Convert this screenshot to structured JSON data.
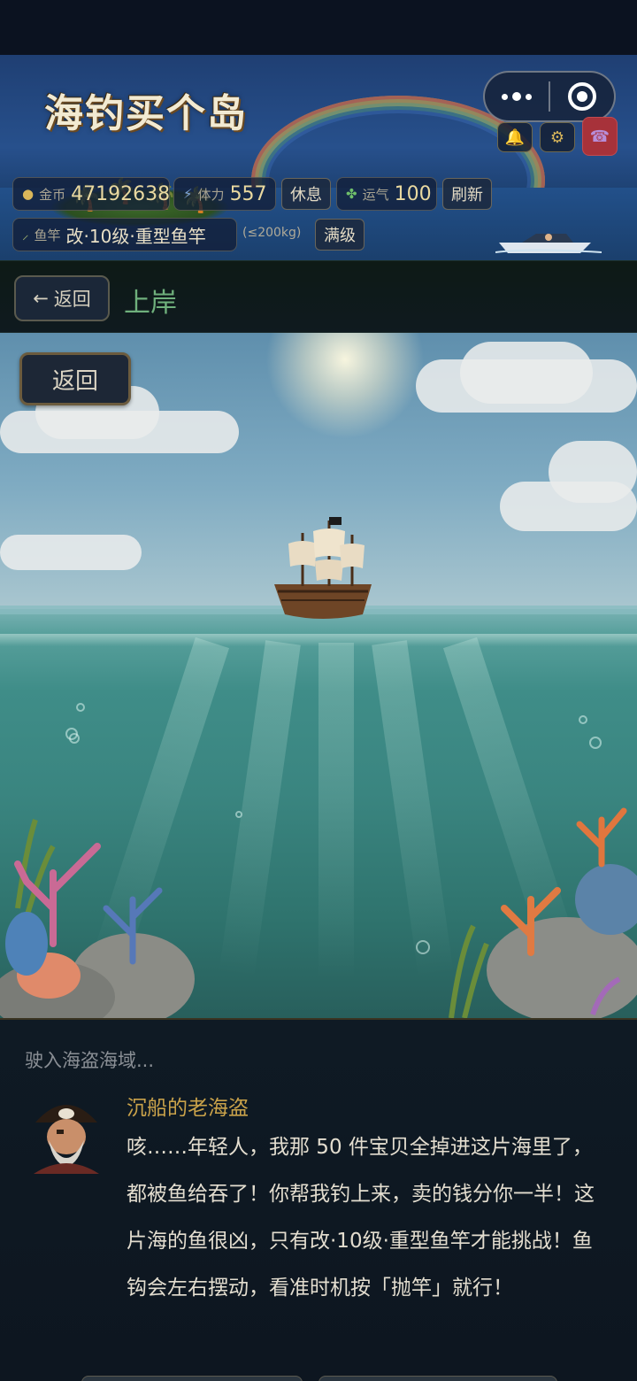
{
  "header": {
    "logo_text": "海钓买个岛",
    "stats": {
      "gold_label": "金币",
      "gold_value": "47192638",
      "stamina_label": "体力",
      "stamina_value": "557",
      "rest_button": "休息",
      "luck_label": "运气",
      "luck_value": "100",
      "refresh_button": "刷新",
      "rod_label": "鱼竿",
      "rod_value": "改·10级·重型鱼竿",
      "rod_capacity": "(≤200kg)",
      "max_level_button": "满级"
    },
    "icons": [
      "bell-icon",
      "gear-icon",
      "phone-icon"
    ]
  },
  "nav": {
    "back_label": "返回",
    "title": "上岸"
  },
  "scene": {
    "back_label": "返回"
  },
  "dialog": {
    "intro": "驶入海盗海域...",
    "speaker": "沉船的老海盗",
    "text": "咳……年轻人，我那 50 件宝贝全掉进这片海里了，都被鱼给吞了！你帮我钓上来，卖的钱分你一半！这片海的鱼很凶，只有改·10级·重型鱼竿才能挑战！鱼钩会左右摆动，看准时机按「抛竿」就行！"
  },
  "colors": {
    "gold": "#d9b65a",
    "nav_title": "#6fb07c",
    "speaker": "#c9a24a"
  }
}
